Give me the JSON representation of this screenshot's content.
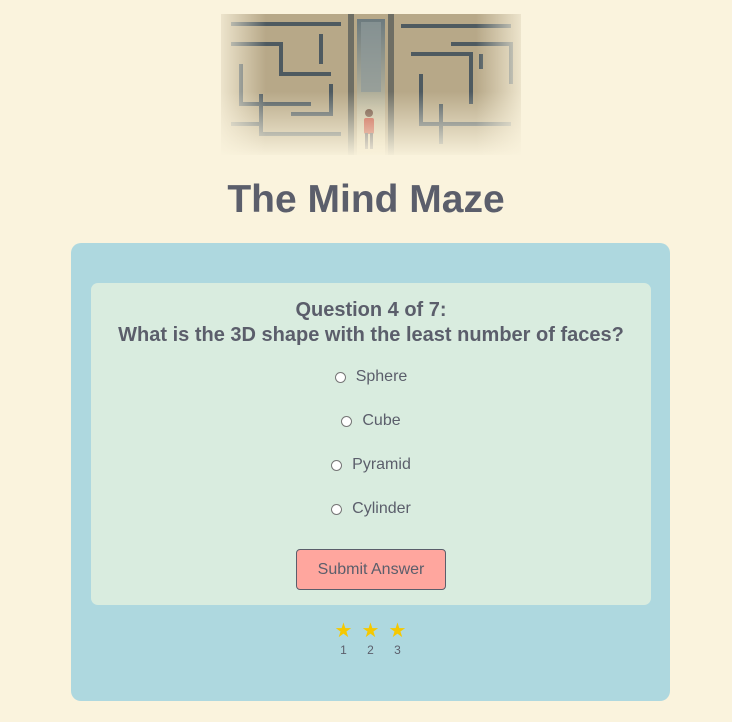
{
  "app": {
    "title": "The Mind Maze",
    "hero_image": "maze-illustration"
  },
  "question": {
    "number_label": "Question 4 of 7:",
    "text": "What is the 3D shape with the least number of faces?",
    "options": [
      {
        "label": "Sphere",
        "selected": false
      },
      {
        "label": "Cube",
        "selected": false
      },
      {
        "label": "Pyramid",
        "selected": false
      },
      {
        "label": "Cylinder",
        "selected": false
      }
    ],
    "submit_label": "Submit Answer"
  },
  "progress": {
    "stars": [
      {
        "label": "1",
        "icon": "star-icon"
      },
      {
        "label": "2",
        "icon": "star-icon"
      },
      {
        "label": "3",
        "icon": "star-icon"
      }
    ]
  },
  "colors": {
    "background": "#faf3dd",
    "panel": "#aed8df",
    "card": "#d9ecdf",
    "button": "#ffa69e",
    "text": "#5b5e6b",
    "star": "#f5c800"
  }
}
